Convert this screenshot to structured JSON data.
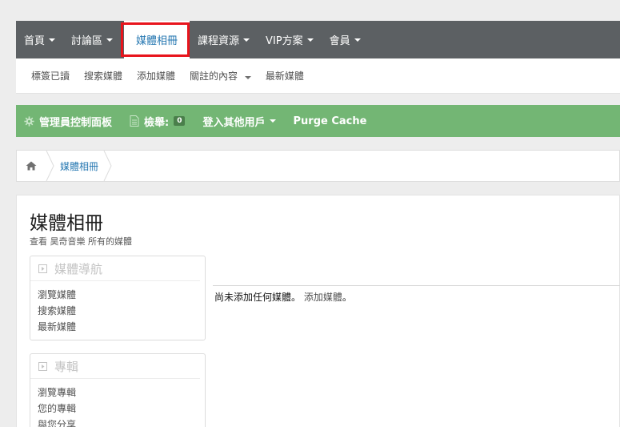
{
  "nav": {
    "tabs": [
      {
        "label": "首頁",
        "has_caret": true
      },
      {
        "label": "討論區",
        "has_caret": true
      },
      {
        "label": "媒體相冊",
        "has_caret": false,
        "selected": true
      },
      {
        "label": "課程資源",
        "has_caret": true
      },
      {
        "label": "VIP方案",
        "has_caret": true
      },
      {
        "label": "會員",
        "has_caret": true
      }
    ],
    "sub_links": [
      "標簽已讀",
      "搜索媒體",
      "添加媒體",
      "關註的內容",
      "最新媒體"
    ]
  },
  "admin_bar": {
    "control_panel": "管理員控制面板",
    "reports_label": "檢舉:",
    "reports_count": "0",
    "login_as": "登入其他用戶",
    "purge_cache": "Purge Cache"
  },
  "breadcrumb": {
    "items": [
      "媒體相冊"
    ]
  },
  "page": {
    "title": "媒體相冊",
    "description": "查看 昊奇音樂 所有的媒體"
  },
  "blocks": [
    {
      "title": "媒體導航",
      "links": [
        "瀏覽媒體",
        "搜索媒體",
        "最新媒體"
      ]
    },
    {
      "title": "專輯",
      "links": [
        "瀏覽專輯",
        "您的專輯",
        "與您分享"
      ]
    }
  ],
  "empty_state": {
    "message": "尚未添加任何媒體。",
    "link": "添加媒體",
    "suffix": "。"
  },
  "colors": {
    "nav_bg": "#5c6063",
    "accent": "#2577b1",
    "admin_green": "#73b674",
    "highlight": "#e8141c"
  }
}
